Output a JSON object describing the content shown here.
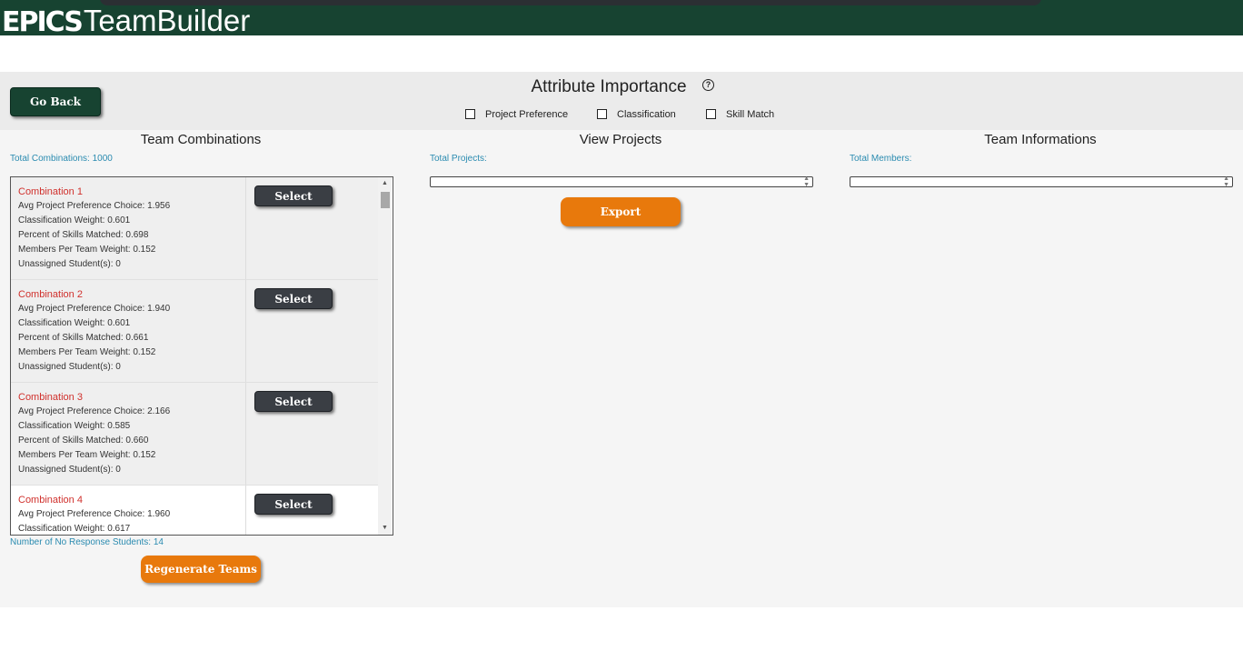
{
  "header": {
    "brand_bold": "EPICS",
    "brand_light": "TeamBuilder"
  },
  "nav": {
    "go_back_label": "Go Back"
  },
  "attribute_importance": {
    "title": "Attribute Importance",
    "help_icon_glyph": "?",
    "options": [
      "Project Preference",
      "Classification",
      "Skill Match"
    ]
  },
  "team_combinations": {
    "title": "Team Combinations",
    "total_label": "Total Combinations: 1000",
    "select_label": "Select",
    "items": [
      {
        "title": "Combination 1",
        "lines": [
          "Avg Project Preference Choice: 1.956",
          "Classification Weight: 0.601",
          "Percent of Skills Matched: 0.698",
          "Members Per Team Weight: 0.152",
          "Unassigned Student(s): 0"
        ]
      },
      {
        "title": "Combination 2",
        "lines": [
          "Avg Project Preference Choice: 1.940",
          "Classification Weight: 0.601",
          "Percent of Skills Matched: 0.661",
          "Members Per Team Weight: 0.152",
          "Unassigned Student(s): 0"
        ]
      },
      {
        "title": "Combination 3",
        "lines": [
          "Avg Project Preference Choice: 2.166",
          "Classification Weight: 0.585",
          "Percent of Skills Matched: 0.660",
          "Members Per Team Weight: 0.152",
          "Unassigned Student(s): 0"
        ]
      },
      {
        "title": "Combination 4",
        "lines": [
          "Avg Project Preference Choice: 1.960",
          "Classification Weight: 0.617"
        ]
      }
    ],
    "no_response_label": "Number of No Response Students: 14",
    "regenerate_label": "Regenerate Teams"
  },
  "view_projects": {
    "title": "View Projects",
    "total_label": "Total Projects:",
    "export_label": "Export"
  },
  "team_informations": {
    "title": "Team Informations",
    "total_label": "Total Members:"
  },
  "colors": {
    "brand_green": "#174331",
    "accent_orange": "#e8790c",
    "combo_title_red": "#d0312d",
    "meta_blue": "#2a8bb0"
  }
}
